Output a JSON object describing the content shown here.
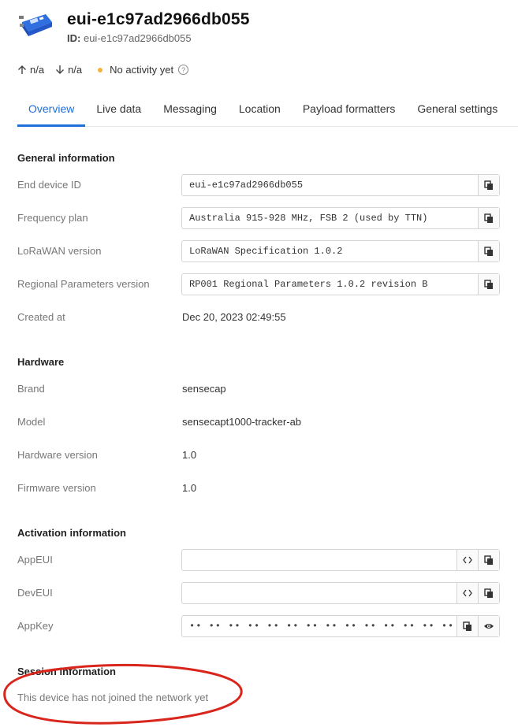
{
  "header": {
    "title": "eui-e1c97ad2966db055",
    "id_label": "ID:",
    "id_value": "eui-e1c97ad2966db055"
  },
  "stats": {
    "uplink": "n/a",
    "downlink": "n/a",
    "activity": "No activity yet",
    "activity_color": "#f5b23d"
  },
  "tabs": [
    {
      "label": "Overview",
      "active": true
    },
    {
      "label": "Live data"
    },
    {
      "label": "Messaging"
    },
    {
      "label": "Location"
    },
    {
      "label": "Payload formatters"
    },
    {
      "label": "General settings"
    }
  ],
  "general": {
    "title": "General information",
    "end_device_id": {
      "label": "End device ID",
      "value": "eui-e1c97ad2966db055"
    },
    "frequency_plan": {
      "label": "Frequency plan",
      "value": "Australia 915-928 MHz, FSB 2 (used by TTN)"
    },
    "lorawan_version": {
      "label": "LoRaWAN version",
      "value": "LoRaWAN Specification 1.0.2"
    },
    "regional_params": {
      "label": "Regional Parameters version",
      "value": "RP001 Regional Parameters 1.0.2 revision B"
    },
    "created_at": {
      "label": "Created at",
      "value": "Dec 20, 2023 02:49:55"
    }
  },
  "hardware": {
    "title": "Hardware",
    "brand": {
      "label": "Brand",
      "value": "sensecap"
    },
    "model": {
      "label": "Model",
      "value": "sensecapt1000-tracker-ab"
    },
    "hw_version": {
      "label": "Hardware version",
      "value": "1.0"
    },
    "fw_version": {
      "label": "Firmware version",
      "value": "1.0"
    }
  },
  "activation": {
    "title": "Activation information",
    "app_eui": {
      "label": "AppEUI",
      "value": ""
    },
    "dev_eui": {
      "label": "DevEUI",
      "value": ""
    },
    "app_key": {
      "label": "AppKey",
      "value": "•• •• •• •• •• •• •• •• •• •• •• •• •• •• •• ••"
    }
  },
  "session": {
    "title": "Session information",
    "note": "This device has not joined the network yet"
  },
  "colors": {
    "accent": "#1e6fd9",
    "annotation": "#d9261c"
  }
}
